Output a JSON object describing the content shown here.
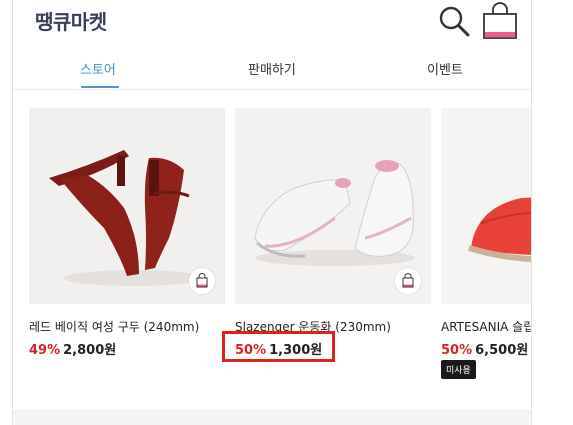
{
  "app": {
    "logo": "땡큐마켓"
  },
  "header": {
    "search_icon": "search-icon",
    "cart_icon": "shopping-bag-icon"
  },
  "tabs": [
    {
      "label": "스토어",
      "active": true
    },
    {
      "label": "판매하기",
      "active": false
    },
    {
      "label": "이벤트",
      "active": false
    }
  ],
  "products": [
    {
      "name": "레드 베이직 여성 구두 (240mm)",
      "discount": "49%",
      "price": "2,800원"
    },
    {
      "name": "Slazenger 운동화 (230mm)",
      "discount": "50%",
      "price": "1,300원"
    },
    {
      "name": "ARTESANIA 슬립",
      "discount": "50%",
      "price": "6,500원",
      "badge": "미사용"
    }
  ],
  "colors": {
    "accent": "#3f8fcf",
    "discount": "#d92323",
    "highlight": "#e0201b"
  }
}
